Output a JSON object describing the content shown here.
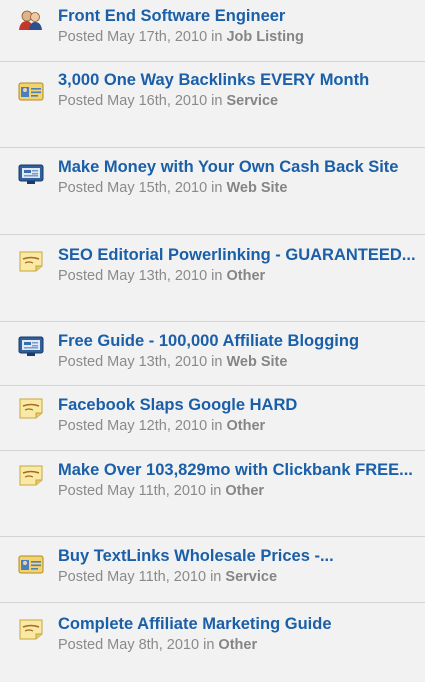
{
  "listings": [
    {
      "title": "Front End Software Engineer",
      "posted": "Posted May 17th, 2010 in",
      "category": "Job Listing",
      "icon": "people-icon"
    },
    {
      "title": "3,000 One Way Backlinks EVERY Month",
      "posted": "Posted May 16th, 2010 in",
      "category": "Service",
      "icon": "id-card-icon"
    },
    {
      "title": "Make Money with Your Own Cash Back Site",
      "posted": "Posted May 15th, 2010 in",
      "category": "Web Site",
      "icon": "monitor-icon"
    },
    {
      "title": "SEO Editorial Powerlinking - GUARANTEED...",
      "posted": "Posted May 13th, 2010 in",
      "category": "Other",
      "icon": "other-note-icon"
    },
    {
      "title": "Free Guide - 100,000 Affiliate Blogging",
      "posted": "Posted May 13th, 2010 in",
      "category": "Web Site",
      "icon": "monitor-icon"
    },
    {
      "title": "Facebook Slaps Google HARD",
      "posted": "Posted May 12th, 2010 in",
      "category": "Other",
      "icon": "other-note-icon"
    },
    {
      "title": "Make Over 103,829mo with Clickbank FREE...",
      "posted": "Posted May 11th, 2010 in",
      "category": "Other",
      "icon": "other-note-icon"
    },
    {
      "title": "Buy TextLinks Wholesale Prices -...",
      "posted": "Posted May 11th, 2010 in",
      "category": "Service",
      "icon": "id-card-icon"
    },
    {
      "title": "Complete Affiliate Marketing Guide",
      "posted": "Posted May 8th, 2010 in",
      "category": "Other",
      "icon": "other-note-icon"
    }
  ],
  "colors": {
    "link": "#1a5fa8",
    "meta_text": "#8a8a8a",
    "divider": "#d4d4d4",
    "background": "#f2f2f2"
  }
}
